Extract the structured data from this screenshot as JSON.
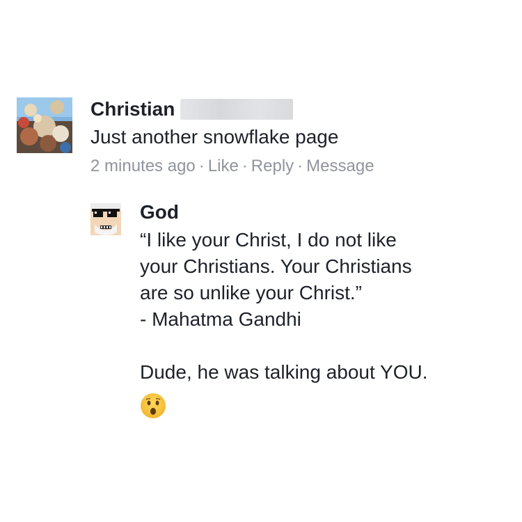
{
  "comment": {
    "author": "Christian",
    "text": "Just another snowflake page",
    "meta": {
      "time": "2 minutes ago",
      "separator": "·",
      "actions": [
        "Like",
        "Reply",
        "Message"
      ]
    }
  },
  "reply": {
    "author": "God",
    "quote_lines": [
      "“I like your Christ, I do not like",
      "your Christians. Your Christians",
      "are so unlike your Christ.”",
      "- Mahatma Gandhi"
    ],
    "followup": "Dude, he was talking about YOU.",
    "emoji": "hushed-face-emoji"
  },
  "colors": {
    "text": "#1d2129",
    "meta": "#90949c",
    "emoji": "#f7c53c"
  }
}
